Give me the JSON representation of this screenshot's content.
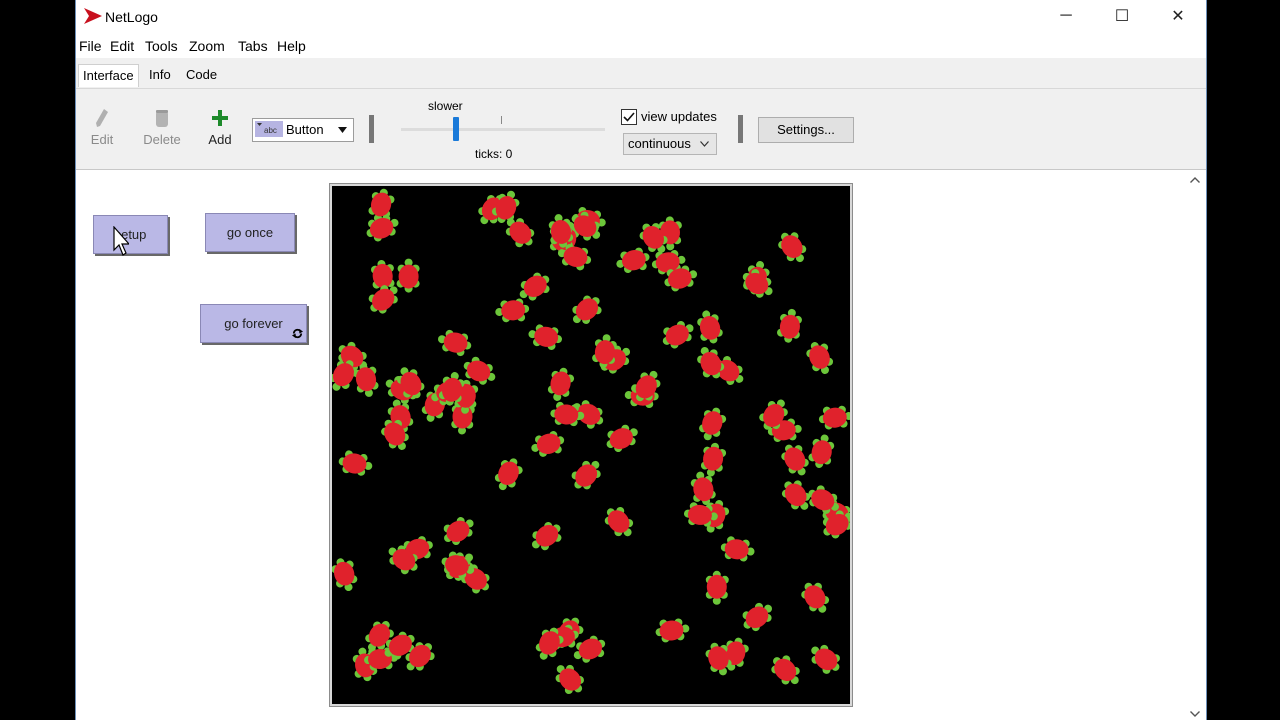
{
  "window": {
    "title": "NetLogo",
    "minimize": "─",
    "maximize": "☐",
    "close": "✕"
  },
  "menu": [
    "File",
    "Edit",
    "Tools",
    "Zoom",
    "Tabs",
    "Help"
  ],
  "tabs": [
    {
      "label": "Interface",
      "active": true
    },
    {
      "label": "Info",
      "active": false
    },
    {
      "label": "Code",
      "active": false
    }
  ],
  "toolbar": {
    "edit_label": "Edit",
    "delete_label": "Delete",
    "add_label": "Add",
    "widget_type": "Button",
    "widget_icon_text": "abc",
    "speed_label": "slower",
    "speed_value": 0.27,
    "ticks_label": "ticks: 0",
    "view_updates_label": "view updates",
    "view_updates_checked": true,
    "update_mode": "continuous",
    "settings_label": "Settings..."
  },
  "buttons": {
    "setup_label": "setup",
    "go_once_label": "go once",
    "go_forever_label": "go forever"
  },
  "world": {
    "background": "#000000",
    "turtle_body_color": "#e0222c",
    "turtle_limb_color": "#6cc63a",
    "turtle_count": 100
  },
  "colors": {
    "button_fill": "#bab8e6",
    "accent": "#1a7ad9",
    "brand": "#c8101e"
  }
}
